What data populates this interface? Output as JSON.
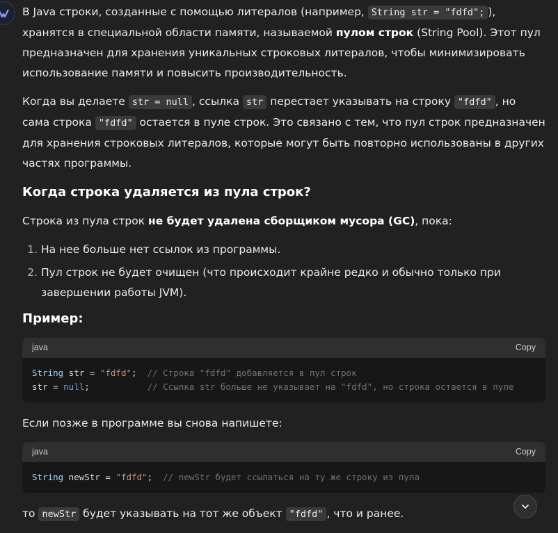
{
  "assistant": {
    "avatar_icon": "assistant-logo-icon"
  },
  "p1": {
    "t1": "В Java строки, созданные с помощью литералов (например, ",
    "code1": "String str = \"fdfd\";",
    "t2": "), хранятся в специальной области памяти, называемой ",
    "bold1": "пулом строк",
    "t3": " (String Pool). Этот пул предназначен для хранения уникальных строковых литералов, чтобы минимизировать использование памяти и повысить производительность."
  },
  "p2": {
    "t1": "Когда вы делаете ",
    "code1": "str = null",
    "t2": ", ссылка ",
    "code2": "str",
    "t3": " перестает указывать на строку ",
    "code3": "\"fdfd\"",
    "t4": ", но сама строка ",
    "code4": "\"fdfd\"",
    "t5": " остается в пуле строк. Это связано с тем, что пул строк предназначен для хранения строковых литералов, которые могут быть повторно использованы в других частях программы."
  },
  "heading1": "Когда строка удаляется из пула строк?",
  "p3": {
    "t1": "Строка из пула строк ",
    "bold1": "не будет удалена сборщиком мусора (GC)",
    "t2": ", пока:"
  },
  "list": [
    "На нее больше нет ссылок из программы.",
    "Пул строк не будет очищен (что происходит крайне редко и обычно только при завершении работы JVM)."
  ],
  "heading2": "Пример:",
  "code_block1": {
    "lang": "java",
    "copy_label": "Copy",
    "line1": {
      "type": "String",
      "rest": " str = ",
      "str": "\"fdfd\"",
      "semi": ";",
      "comment": "  // Строка \"fdfd\" добавляется в пул строк"
    },
    "line2": {
      "id": "str",
      "eq": " = ",
      "kw": "null",
      "semi": ";",
      "comment": "           // Ссылка str больше не указывает на \"fdfd\", но строка остается в пуле"
    }
  },
  "p4": "Если позже в программе вы снова напишете:",
  "code_block2": {
    "lang": "java",
    "copy_label": "Copy",
    "line1": {
      "type": "String",
      "rest": " newStr = ",
      "str": "\"fdfd\"",
      "semi": ";",
      "comment": "  // newStr будет ссылаться на ту же строку из пула"
    }
  },
  "p5": {
    "t1": "то ",
    "code1": "newStr",
    "t2": " будет указывать на тот же объект ",
    "code2": "\"fdfd\"",
    "t3": ", что и ранее."
  },
  "scroll_button_icon": "chevron-down-icon"
}
